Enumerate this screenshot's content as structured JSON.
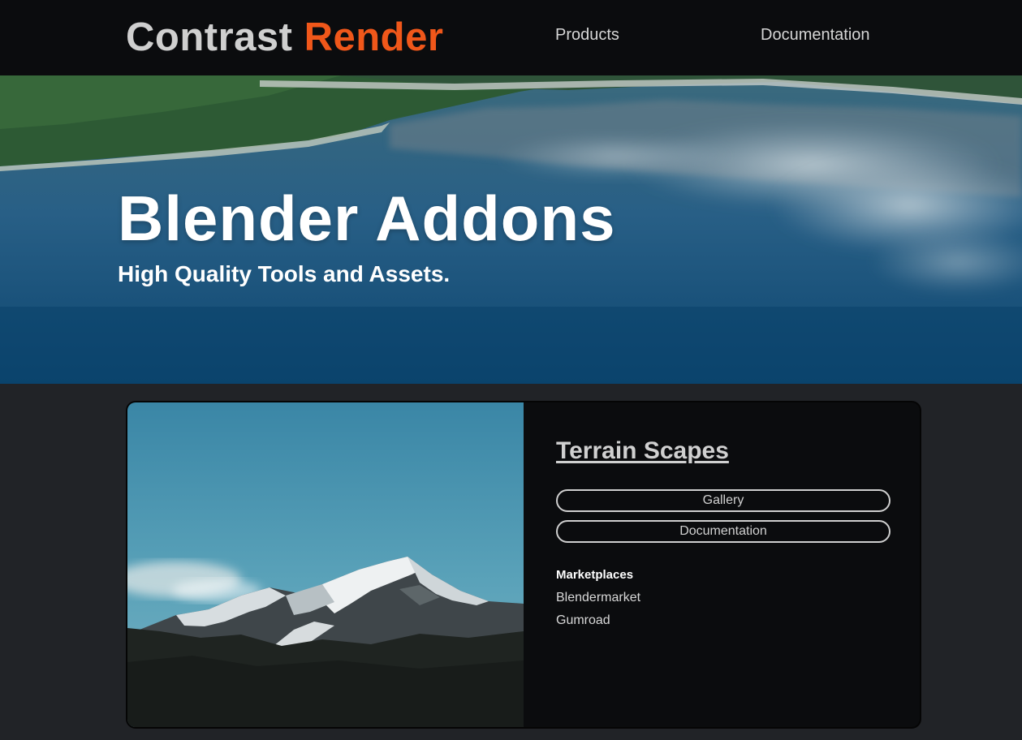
{
  "header": {
    "logo_part1": "Contrast",
    "logo_part2": "Render",
    "nav": {
      "products": "Products",
      "documentation": "Documentation"
    }
  },
  "hero": {
    "title": "Blender Addons",
    "subtitle": "High Quality Tools and Assets."
  },
  "product": {
    "title": "Terrain Scapes",
    "buttons": {
      "gallery": "Gallery",
      "documentation": "Documentation"
    },
    "marketplaces_heading": "Marketplaces",
    "marketplaces": [
      "Blendermarket",
      "Gumroad"
    ]
  },
  "colors": {
    "accent": "#f0571a",
    "nav_background": "#0b0c0e",
    "page_background": "#212327",
    "text_light": "#d0d0d0"
  }
}
